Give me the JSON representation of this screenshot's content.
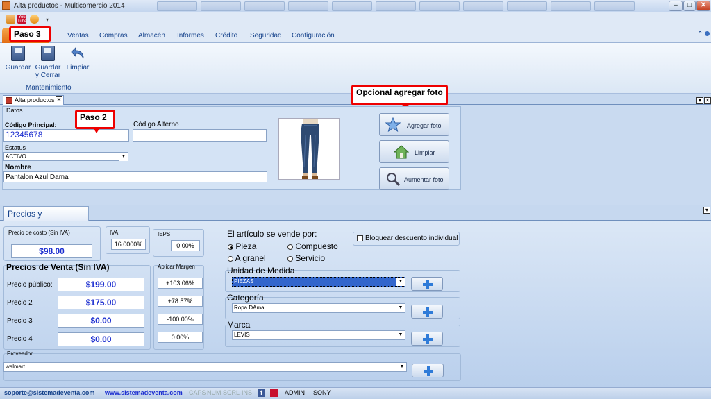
{
  "window": {
    "title": "Alta productos - Multicomercio 2014"
  },
  "quick_access": {
    "youtube": "You Tube"
  },
  "ribbon": {
    "tabs": [
      "Ventas",
      "Compras",
      "Almacén",
      "Informes",
      "Crédito",
      "Seguridad",
      "Configuración"
    ],
    "buttons": {
      "guardar": "Guardar",
      "guardar_cerrar_1": "Guardar",
      "guardar_cerrar_2": "y Cerrar",
      "limpiar": "Limpiar"
    },
    "group_label": "Mantenimiento"
  },
  "callouts": {
    "paso3": "Paso 3",
    "paso2": "Paso 2",
    "foto": "Opcional agregar foto"
  },
  "doc_tab": {
    "label": "Alta productos"
  },
  "datos": {
    "title": "Datos",
    "codigo_principal_label": "Código Principal:",
    "codigo_principal": "12345678",
    "codigo_alterno_label": "Código Alterno",
    "codigo_alterno": "",
    "estatus_label": "Estatus",
    "estatus": "ACTIVO",
    "nombre_label": "Nombre",
    "nombre": "Pantalon Azul Dama",
    "agregar_foto": "Agregar foto",
    "limpiar": "Limpiar",
    "aumentar_foto": "Aumentar foto"
  },
  "precios": {
    "tab_label": "Precios y organización",
    "costo_label": "Precio de costo (Sin IVA)",
    "costo": "$98.00",
    "iva_label": "IVA",
    "iva": "16.0000%",
    "ieps_label": "IEPS",
    "ieps": "0.00%",
    "venta_title": "Precios de Venta (Sin IVA)",
    "margen_title": "Aplicar Margen",
    "rows": [
      {
        "label": "Precio público:",
        "price": "$199.00",
        "margin": "+103.06%"
      },
      {
        "label": "Precio 2",
        "price": "$175.00",
        "margin": "+78.57%"
      },
      {
        "label": "Precio 3",
        "price": "$0.00",
        "margin": "-100.00%"
      },
      {
        "label": "Precio 4",
        "price": "$0.00",
        "margin": "0.00%"
      }
    ],
    "vende_title": "El artículo se vende por:",
    "options": {
      "pieza": "Pieza",
      "compuesto": "Compuesto",
      "a_granel": "A granel",
      "servicio": "Servicio"
    },
    "selected_option": "Pieza",
    "bloquear": "Bloquear descuento individual",
    "unidad_title": "Unidad de Medida",
    "unidad": "PIEZAS",
    "categoria_title": "Categoría",
    "categoria": "Ropa DAma",
    "marca_title": "Marca",
    "marca": "LEVIS",
    "proveedor_title": "Proveedor",
    "proveedor": "walmart"
  },
  "status": {
    "email": "soporte@sistemadeventa.com",
    "web": "www.sistemadeventa.com",
    "caps": "CAPS",
    "num": "NUM",
    "scrl": "SCRL",
    "ins": "INS",
    "user": "ADMIN",
    "machine": "SONY"
  },
  "colors": {
    "accent": "#15428b",
    "callout_border": "#ee0000",
    "price_text": "#1d2fd0",
    "file_button": "#e36d12"
  }
}
